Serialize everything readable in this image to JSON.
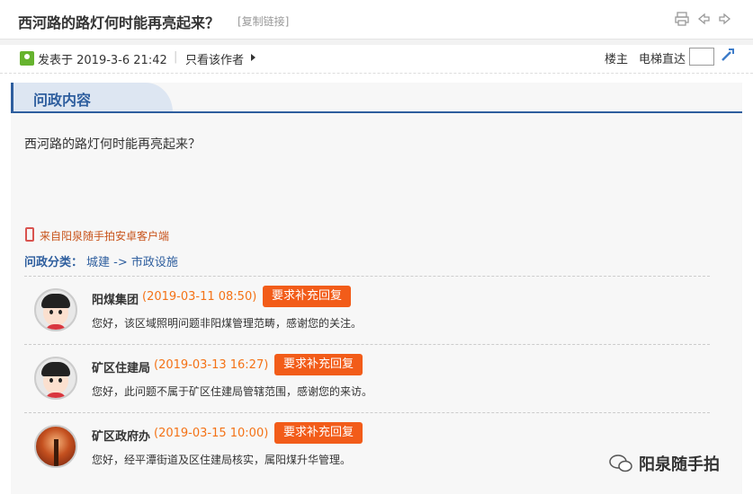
{
  "header": {
    "title": "西河路的路灯何时能再亮起来？",
    "copy_link": "[复制链接]",
    "icons": [
      "print-icon",
      "prev-arrow-icon",
      "next-arrow-icon"
    ]
  },
  "meta": {
    "posted": "发表于 2019-3-6 21:42",
    "separator": "|",
    "author_only": "只看该作者",
    "floor_label": "楼主",
    "elevator_label": "电梯直达",
    "floor_input_value": ""
  },
  "section": {
    "tab_label": "问政内容"
  },
  "post": {
    "content": "西河路的路灯何时能再亮起来？",
    "source": "来自阳泉随手拍安卓客户端",
    "category_label": "问政分类：",
    "category_value": "城建 -> 市政设施"
  },
  "replies": [
    {
      "name": "阳煤集团",
      "date": "(2019-03-11 08:50)",
      "button": "要求补充回复",
      "text": "您好，该区域照明问题非阳煤管理范畴，感谢您的关注。",
      "avatar": "cartoon-girl"
    },
    {
      "name": "矿区住建局",
      "date": "(2019-03-13 16:27)",
      "button": "要求补充回复",
      "text": "您好，此问题不属于矿区住建局管辖范围，感谢您的来访。",
      "avatar": "cartoon-girl"
    },
    {
      "name": "矿区政府办",
      "date": "(2019-03-15 10:00)",
      "button": "要求补充回复",
      "text": "您好，经平潭街道及区住建局核实，属阳煤升华管理。",
      "avatar": "autumn-photo"
    }
  ],
  "watermark": {
    "text": "阳泉随手拍"
  },
  "colors": {
    "accent_blue": "#2e5e9e",
    "date_orange": "#f47216",
    "button_orange": "#f25c19"
  }
}
